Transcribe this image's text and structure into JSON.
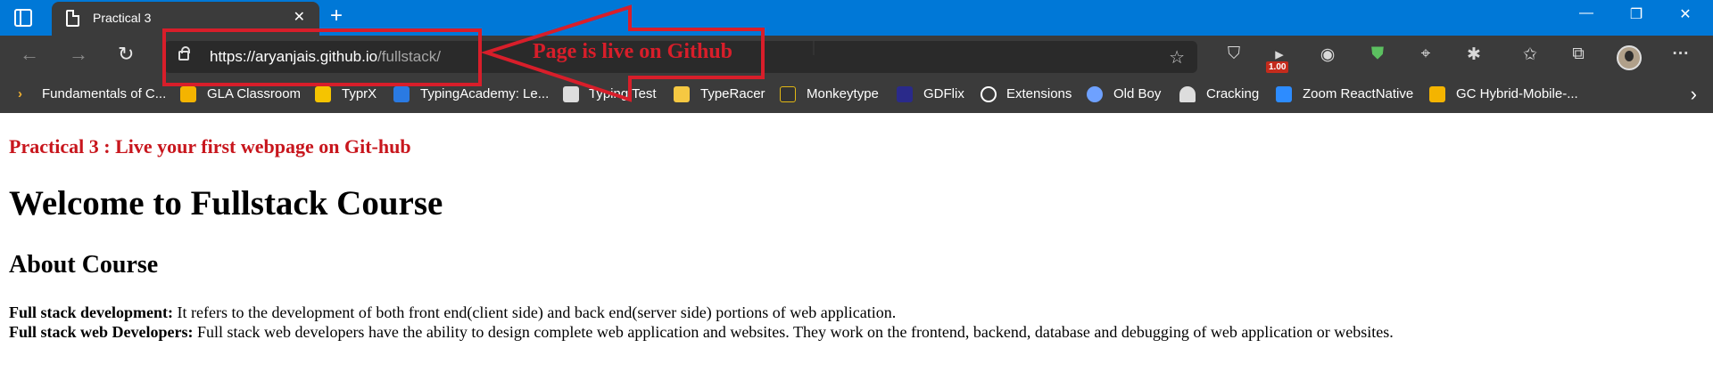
{
  "window": {
    "tab_title": "Practical 3",
    "tab_close": "✕",
    "new_tab": "+",
    "minimize": "—",
    "restore": "❐",
    "close": "✕"
  },
  "toolbar": {
    "back": "←",
    "forward": "→",
    "refresh": "↻",
    "url_host": "https://aryanjais.github.io",
    "url_path": "/fullstack/",
    "favorite_star": "☆",
    "extensions": [
      "shield-icon",
      "counter-icon",
      "globe-icon",
      "check-shield-icon",
      "mouse-icon",
      "puzzle-icon",
      "favorites-icon",
      "collections-icon"
    ],
    "ext_badge": "1.00",
    "more": "···"
  },
  "favorites": {
    "items": [
      {
        "label": "Fundamentals of C...",
        "icon": "folder-icon",
        "color": "#f0b030"
      },
      {
        "label": "GLA Classroom",
        "icon": "classroom-icon",
        "color": "#f4b400"
      },
      {
        "label": "TyprX",
        "icon": "typrx-icon",
        "color": "#f5c400"
      },
      {
        "label": "TypingAcademy: Le...",
        "icon": "typingacademy-icon",
        "color": "#2a7ae2"
      },
      {
        "label": "Typing Test",
        "icon": "keyboard-icon",
        "color": "#dddddd"
      },
      {
        "label": "TypeRacer",
        "icon": "typeracer-icon",
        "color": "#f5c842"
      },
      {
        "label": "Monkeytype",
        "icon": "monkeytype-icon",
        "color": "#e2b714"
      },
      {
        "label": "GDFlix",
        "icon": "gdflix-icon",
        "color": "#2a2a8a"
      },
      {
        "label": "Extensions",
        "icon": "extensions-icon",
        "color": "#ffffff"
      },
      {
        "label": "Old Boy",
        "icon": "oldboy-icon",
        "color": "#6ea1ff"
      },
      {
        "label": "Cracking",
        "icon": "cracking-icon",
        "color": "#dddddd"
      },
      {
        "label": "Zoom ReactNative",
        "icon": "zoom-icon",
        "color": "#2d8cff"
      },
      {
        "label": "GC Hybrid-Mobile-...",
        "icon": "classroom-icon",
        "color": "#f4b400"
      }
    ],
    "more": "›"
  },
  "annotation": {
    "text": "Page is live on Github",
    "color": "#d81e2a"
  },
  "page": {
    "practical_heading": "Practical 3 : Live your first webpage on Git-hub",
    "title": "Welcome to Fullstack Course",
    "subtitle": "About Course",
    "def1_term": "Full stack development:",
    "def1_text": " It refers to the development of both front end(client side) and back end(server side) portions of web application.",
    "def2_term": "Full stack web Developers:",
    "def2_text": " Full stack web developers have the ability to design complete web application and websites. They work on the frontend, backend, database and debugging of web application or websites."
  }
}
